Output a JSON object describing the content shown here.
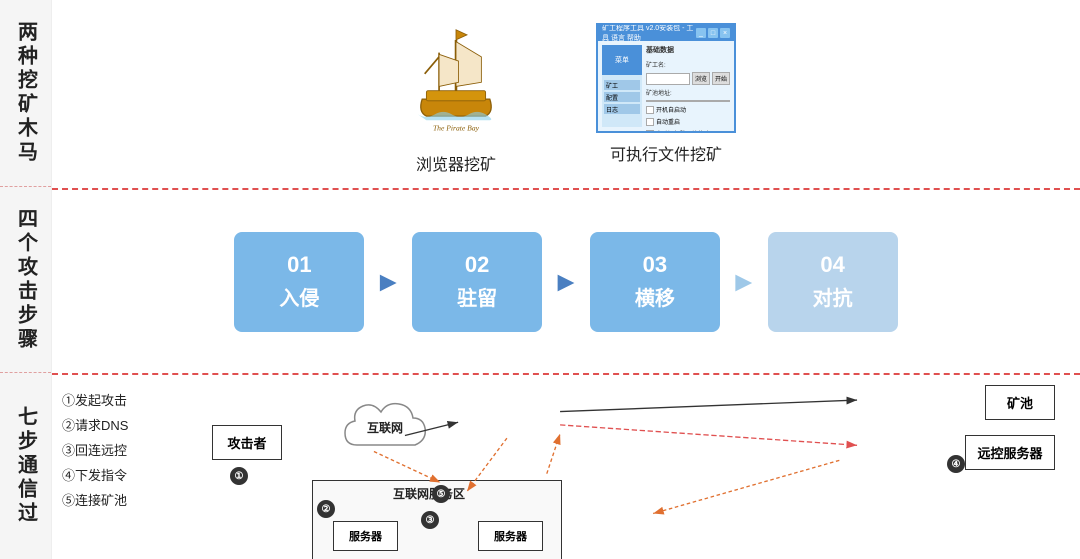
{
  "sidebar": {
    "sections": [
      {
        "id": "s1",
        "text": "两种挖矿木马"
      },
      {
        "id": "s2",
        "text": "四个攻击步骤"
      },
      {
        "id": "s3",
        "text": "七步通信过"
      }
    ]
  },
  "top_section": {
    "items": [
      {
        "id": "browser",
        "label": "浏览器挖矿"
      },
      {
        "id": "exe",
        "label": "可执行文件挖矿"
      }
    ],
    "pirate_bay_subtitle": "The Pirate Bay"
  },
  "steps": [
    {
      "number": "01",
      "name": "入侵"
    },
    {
      "number": "02",
      "name": "驻留"
    },
    {
      "number": "03",
      "name": "横移"
    },
    {
      "number": "04",
      "name": "对抗"
    }
  ],
  "seven_steps": {
    "items": [
      "①发起攻击",
      "②请求DNS",
      "③回连远控",
      "④下发指令",
      "⑤连接矿池"
    ]
  },
  "network": {
    "attacker": "攻击者",
    "internet": "互联网",
    "minepool": "矿池",
    "remote_ctrl": "远控服务器",
    "internet_zone": "互联网服务区",
    "server1": "服务器",
    "server2": "服务器",
    "num1": "①",
    "num2": "②",
    "num3": "③",
    "num4": "④",
    "num5": "⑤"
  },
  "colors": {
    "step_box_bg": "#7bb8e8",
    "arrow_color": "#4a7fc1",
    "dashed_border": "#e05050",
    "sidebar_text": "#222"
  }
}
